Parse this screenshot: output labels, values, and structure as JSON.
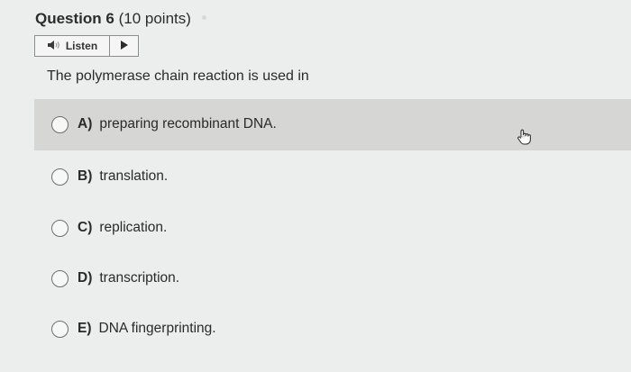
{
  "question": {
    "title": "Question 6",
    "points": "(10 points)"
  },
  "listen": {
    "label": "Listen",
    "speaker_icon": "speaker-icon",
    "play_icon": "play-icon"
  },
  "prompt": "The polymerase chain reaction is used in",
  "options": [
    {
      "letter": "A)",
      "text": "preparing recombinant DNA."
    },
    {
      "letter": "B)",
      "text": "translation."
    },
    {
      "letter": "C)",
      "text": "replication."
    },
    {
      "letter": "D)",
      "text": "transcription."
    },
    {
      "letter": "E)",
      "text": "DNA fingerprinting."
    }
  ],
  "colors": {
    "highlight": "#d6d6d5",
    "background": "#eceded"
  }
}
